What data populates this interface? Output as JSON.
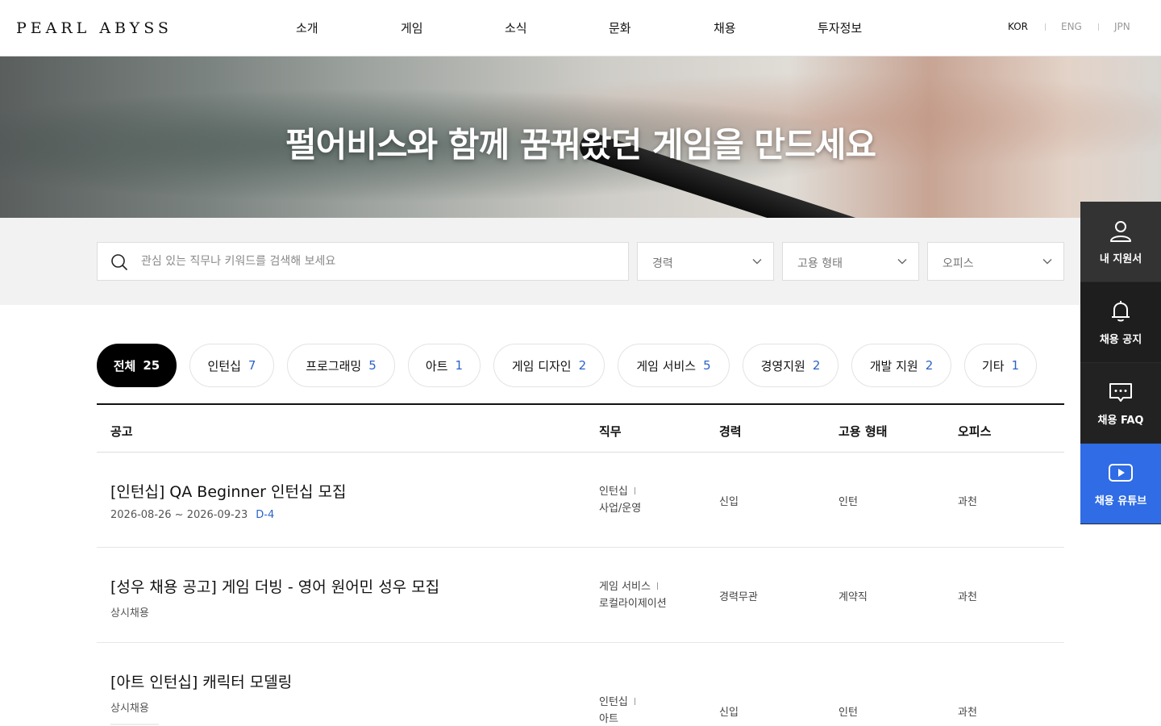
{
  "header": {
    "logo": "PEARL ABYSS",
    "nav": [
      "소개",
      "게임",
      "소식",
      "문화",
      "채용",
      "투자정보"
    ],
    "languages": [
      "KOR",
      "ENG",
      "JPN"
    ],
    "active_language": "KOR"
  },
  "hero": {
    "title": "펄어비스와 함께 꿈꿔왔던 게임을 만드세요"
  },
  "search": {
    "placeholder": "관심 있는 직무나 키워드를 검색해 보세요",
    "filters": [
      "경력",
      "고용 형태",
      "오피스"
    ]
  },
  "categories": [
    {
      "label": "전체",
      "count": "25"
    },
    {
      "label": "인턴십",
      "count": "7"
    },
    {
      "label": "프로그래밍",
      "count": "5"
    },
    {
      "label": "아트",
      "count": "1"
    },
    {
      "label": "게임 디자인",
      "count": "2"
    },
    {
      "label": "게임 서비스",
      "count": "5"
    },
    {
      "label": "경영지원",
      "count": "2"
    },
    {
      "label": "개발 지원",
      "count": "2"
    },
    {
      "label": "기타",
      "count": "1"
    }
  ],
  "table": {
    "headers": [
      "공고",
      "직무",
      "경력",
      "고용 형태",
      "오피스"
    ],
    "rows": [
      {
        "title": "[인턴십] QA Beginner 인턴십 모집",
        "period": "2026-08-26 ~ 2026-09-23",
        "dday": "D-4",
        "job1": "인턴십",
        "job2": "사업/운영",
        "career": "신입",
        "type": "인턴",
        "office": "과천"
      },
      {
        "title": "[성우 채용 공고] 게임 더빙 - 영어 원어민 성우 모집",
        "period": "상시채용",
        "dday": "",
        "job1": "게임 서비스",
        "job2": "로컬라이제이션",
        "career": "경력무관",
        "type": "계약직",
        "office": "과천"
      },
      {
        "title": "[아트 인턴십] 캐릭터 모델링",
        "period": "상시채용",
        "dday": "",
        "job1": "인턴십",
        "job2": "아트",
        "career": "신입",
        "type": "인턴",
        "office": "과천"
      }
    ]
  },
  "side_menu": [
    {
      "label": "내 지원서",
      "icon": "user-icon"
    },
    {
      "label": "채용 공지",
      "icon": "bell-icon"
    },
    {
      "label": "채용 FAQ",
      "icon": "chat-icon"
    },
    {
      "label": "채용 유튜브",
      "icon": "play-icon"
    }
  ],
  "colors": {
    "accent": "#2a63c9",
    "youtube_button": "#2f6ce5",
    "side_dark": "#333333"
  }
}
